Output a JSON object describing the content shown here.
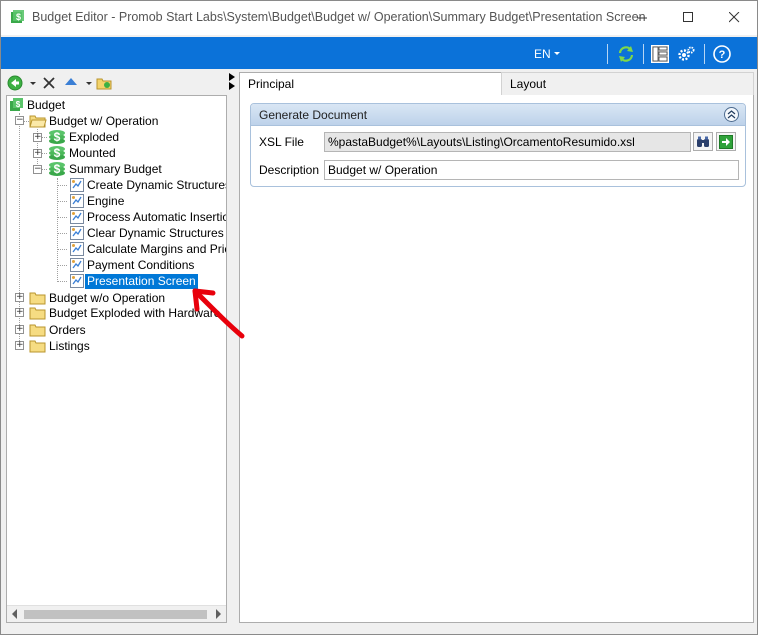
{
  "window": {
    "title": "Budget Editor - Promob Start Labs\\System\\Budget\\Budget w/ Operation\\Summary Budget\\Presentation Screen",
    "controls": [
      "minimize",
      "maximize",
      "close"
    ]
  },
  "toolbar": {
    "language": "EN",
    "icons": [
      "refresh-icon",
      "layout-panel-icon",
      "settings-icon",
      "help-icon"
    ]
  },
  "left_toolbar": {
    "icons": [
      "back-icon",
      "dropdown-icon",
      "delete-icon",
      "move-up-icon",
      "dropdown-icon",
      "folder-refresh-icon"
    ]
  },
  "tree": {
    "root": "Budget",
    "budget_with_operation": "Budget w/ Operation",
    "exploded": "Exploded",
    "mounted": "Mounted",
    "summary_budget": "Summary Budget",
    "children": [
      "Create Dynamic Structures",
      "Engine",
      "Process Automatic Insertion",
      "Clear Dynamic Structures",
      "Calculate Margins and Price",
      "Payment Conditions",
      "Presentation Screen"
    ],
    "budget_without_operation": "Budget w/o Operation",
    "budget_exploded_hardware": "Budget Exploded with Hardware",
    "orders": "Orders",
    "listings": "Listings",
    "selected": "Presentation Screen"
  },
  "tabs": [
    {
      "label": "Principal",
      "active": true
    },
    {
      "label": "Layout",
      "active": false
    }
  ],
  "group": {
    "title": "Generate Document",
    "xsl_label": "XSL File",
    "xsl_value": "%pastaBudget%\\Layouts\\Listing\\OrcamentoResumido.xsl",
    "description_label": "Description",
    "description_value": "Budget w/ Operation"
  },
  "colors": {
    "accent_blue": "#0b72d9",
    "selection": "#0078d7",
    "annotation_arrow": "#e8000b"
  }
}
